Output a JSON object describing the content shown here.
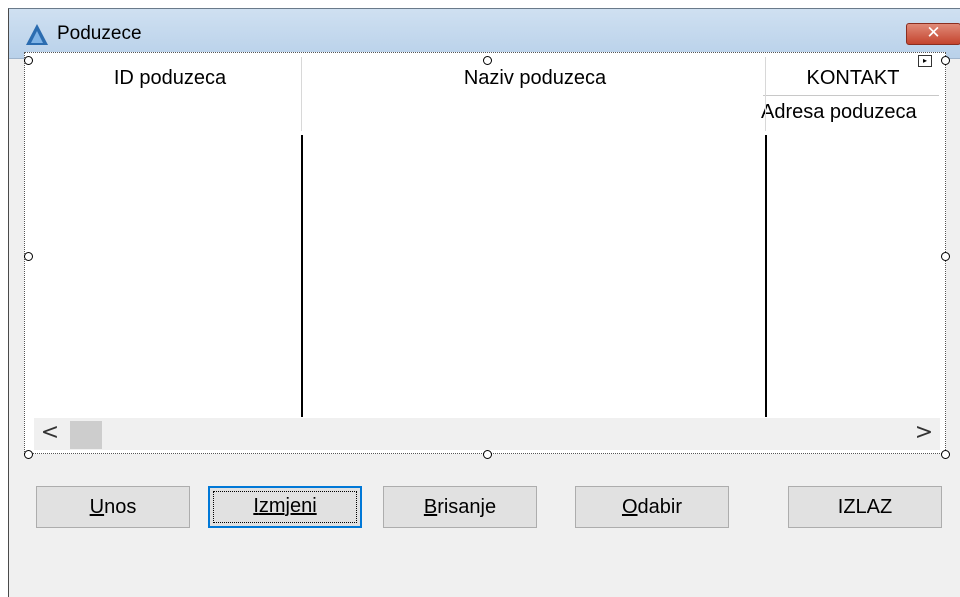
{
  "window": {
    "title": "Poduzece",
    "close_icon": "✕"
  },
  "grid": {
    "columns": [
      {
        "header": "ID poduzeca"
      },
      {
        "header": "Naziv poduzeca"
      },
      {
        "header": "KONTAKT",
        "subheader": "Adresa poduzeca"
      }
    ],
    "scroll_left": "<",
    "scroll_right": ">"
  },
  "buttons": [
    {
      "accel": "U",
      "rest": "nos"
    },
    {
      "accel": "I",
      "rest": "zmjeni"
    },
    {
      "accel": "B",
      "rest": "risanje"
    },
    {
      "accel": "O",
      "rest": "dabir"
    },
    {
      "accel": "",
      "rest": "IZLAZ"
    }
  ],
  "colors": {
    "accent": "#0078d7",
    "close": "#c4442e"
  }
}
